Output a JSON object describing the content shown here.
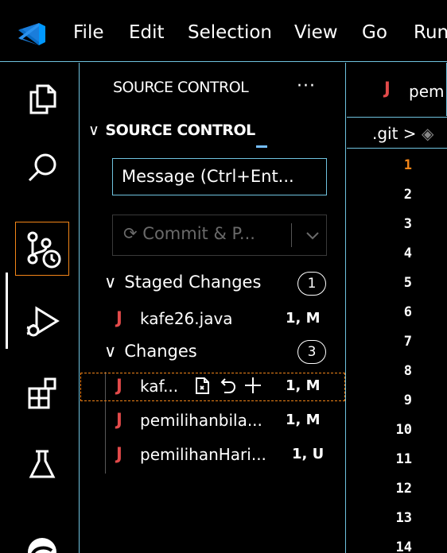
{
  "menubar": {
    "items": [
      "File",
      "Edit",
      "Selection",
      "View",
      "Go",
      "Run"
    ]
  },
  "activity_bar": {
    "items": [
      "explorer-icon",
      "search-icon",
      "source-control-icon",
      "run-debug-icon",
      "extensions-icon",
      "testing-icon",
      "copilot-icon"
    ],
    "active": "source-control-icon"
  },
  "sidebar": {
    "title": "SOURCE CONTROL",
    "more_label": "···",
    "section_title": "SOURCE CONTROL",
    "message_placeholder": "Message (Ctrl+Ent...",
    "commit_label": "Commit & P...",
    "staged": {
      "label": "Staged Changes",
      "count": "1",
      "files": [
        {
          "name": "kafe26.java",
          "status": "1, M"
        }
      ]
    },
    "changes": {
      "label": "Changes",
      "count": "3",
      "files": [
        {
          "name": "kaf...",
          "status": "1, M"
        },
        {
          "name": "pemilihanbila...",
          "status": "1, M"
        },
        {
          "name": "pemilihanHari...",
          "status": "1, U"
        }
      ]
    }
  },
  "editor": {
    "tab_label": "pem",
    "breadcrumb": ".git >",
    "line_numbers": [
      "1",
      "2",
      "3",
      "4",
      "5",
      "6",
      "7",
      "8",
      "9",
      "10",
      "11",
      "12",
      "13",
      "14"
    ],
    "current_line": "1"
  },
  "colors": {
    "contrast_border": "#6fc3df",
    "focus_border": "#f38518",
    "java_icon": "#e24a4a",
    "accent_blue": "#0098ff"
  }
}
